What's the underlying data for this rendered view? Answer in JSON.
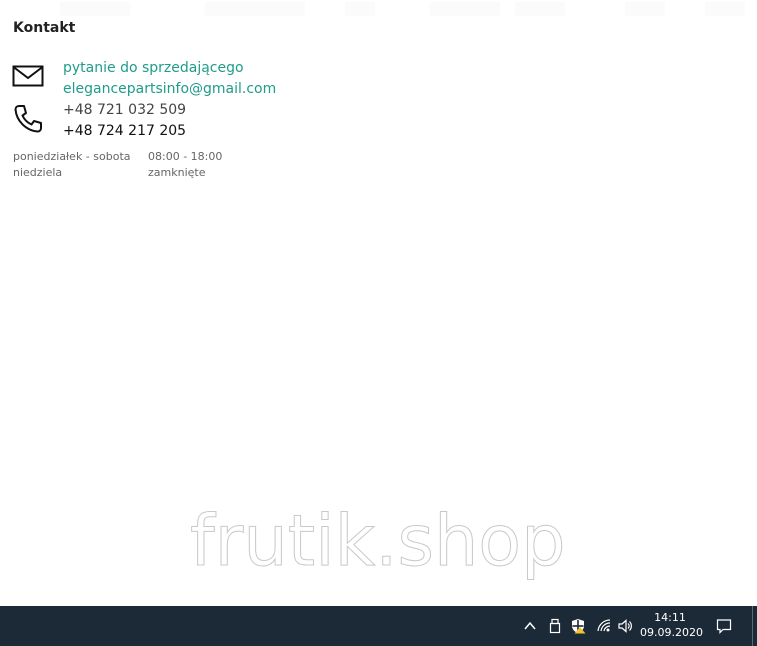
{
  "contact": {
    "title": "Kontakt",
    "ask_seller_label": "pytanie do sprzedającego",
    "email": "elegancepartsinfo@gmail.com",
    "phone_1": "+48 721 032 509",
    "phone_2": "+48 724 217 205",
    "hours": [
      {
        "days": "poniedziałek - sobota",
        "time": "08:00 - 18:00"
      },
      {
        "days": "niedziela",
        "time": "zamknięte"
      }
    ]
  },
  "watermark": "frutik.shop",
  "taskbar": {
    "time": "14:11",
    "date": "09.09.2020",
    "icons": [
      "chevron-up-icon",
      "usb-drive-icon",
      "security-shield-icon",
      "wifi-icon",
      "volume-icon",
      "notification-icon"
    ]
  },
  "colors": {
    "link": "#1f9c8b",
    "taskbar": "#1c2a38"
  }
}
